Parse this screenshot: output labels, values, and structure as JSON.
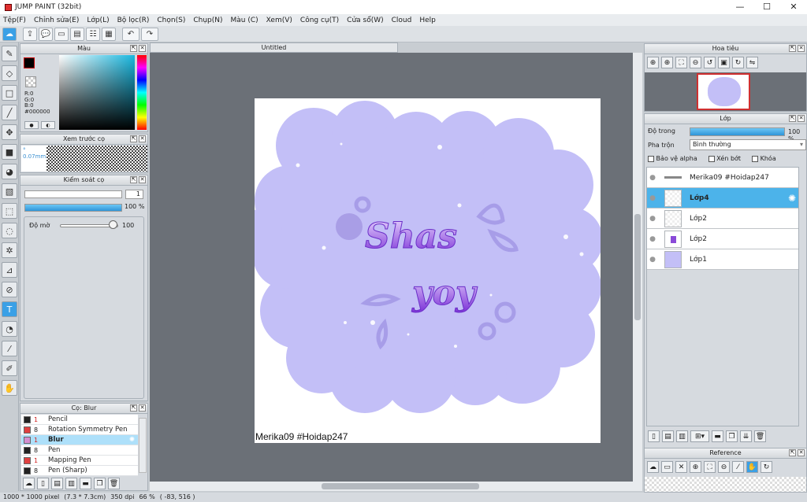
{
  "window": {
    "title": "JUMP PAINT (32bit)",
    "min": "—",
    "max": "☐",
    "close": "✕"
  },
  "menu": [
    "Tệp(F)",
    "Chỉnh sửa(E)",
    "Lớp(L)",
    "Bộ lọc(R)",
    "Chọn(S)",
    "Chụp(N)",
    "Màu (C)",
    "Xem(V)",
    "Công cụ(T)",
    "Cửa sổ(W)",
    "Cloud",
    "Help"
  ],
  "document": {
    "tab_title": "Untitled",
    "watermark": "Merika09 #Hoidap247",
    "art_text_1": "Shas",
    "art_text_2": "yoy"
  },
  "color_panel": {
    "title": "Màu",
    "r": "R:0",
    "g": "G:0",
    "b": "B:0",
    "hex": "#000000",
    "fg": "#000000",
    "bg": "#ffffff"
  },
  "preview_panel": {
    "title": "Xem trước cọ",
    "size": "0.07mm"
  },
  "brush_control": {
    "title": "Kiểm soát cọ",
    "size_value": "1",
    "opacity_pct": "100 %",
    "opacity_fraction": 1.0,
    "blur_label": "Độ mờ",
    "blur_value": "100"
  },
  "brush_list": {
    "title": "Cọ: Blur",
    "items": [
      {
        "size": "1",
        "name": "Pencil",
        "color": "#222222",
        "red_size": true
      },
      {
        "size": "8",
        "name": "Rotation Symmetry Pen",
        "color": "#e04040",
        "red_size": false
      },
      {
        "size": "1",
        "name": "Blur",
        "color": "#d48fd0",
        "red_size": true,
        "selected": true
      },
      {
        "size": "8",
        "name": "Pen",
        "color": "#222222",
        "red_size": false
      },
      {
        "size": "1",
        "name": "Mapping Pen",
        "color": "#e04040",
        "red_size": true
      },
      {
        "size": "8",
        "name": "Pen (Sharp)",
        "color": "#222222",
        "red_size": false
      }
    ]
  },
  "navigator": {
    "title": "Hoa tiêu"
  },
  "layers_panel": {
    "title": "Lớp",
    "opacity_label": "Độ trong",
    "opacity_value": "100 %",
    "opacity_fraction": 1.0,
    "blend_label": "Pha trộn",
    "blend_value": "Bình thường",
    "protect_alpha": "Bảo vệ alpha",
    "clipping": "Xén bớt",
    "lock": "Khóa",
    "layers": [
      {
        "name": "Merika09 #Hoidap247",
        "selected": false
      },
      {
        "name": "Lớp4",
        "selected": true
      },
      {
        "name": "Lớp2",
        "selected": false
      },
      {
        "name": "Lớp2",
        "selected": false
      },
      {
        "name": "Lớp1",
        "selected": false
      }
    ]
  },
  "reference_panel": {
    "title": "Reference"
  },
  "status": {
    "size": "1000 * 1000 pixel",
    "cm": "(7.3 * 7.3cm)",
    "dpi": "350 dpi",
    "zoom": "66 %",
    "coords": "( -83, 516 )"
  }
}
